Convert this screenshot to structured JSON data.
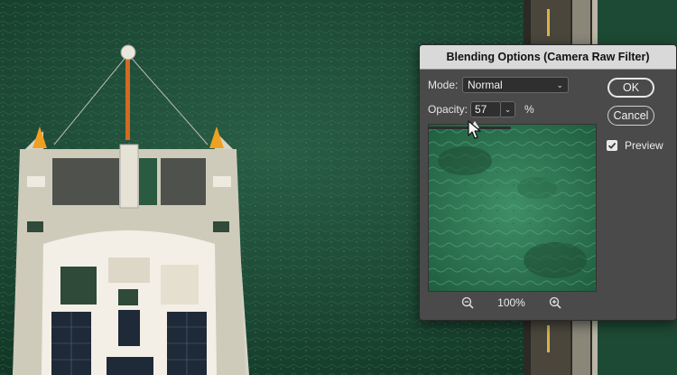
{
  "dialog": {
    "title": "Blending Options (Camera Raw Filter)",
    "mode_label": "Mode:",
    "mode_value": "Normal",
    "opacity_label": "Opacity:",
    "opacity_value": "57",
    "opacity_unit": "%",
    "opacity_fraction": 0.57,
    "zoom_level": "100%",
    "ok_label": "OK",
    "cancel_label": "Cancel",
    "preview_label": "Preview",
    "preview_checked": true
  },
  "icons": {
    "mode_dropdown": "chevron-down-icon",
    "opacity_dropdown": "chevron-down-icon",
    "zoom_out": "zoom-out-icon",
    "zoom_in": "zoom-in-icon",
    "preview_check": "checkmark-icon",
    "cursor": "pointer-cursor-icon"
  },
  "colors": {
    "dialog_bg": "#4a4a4a",
    "titlebar_bg": "#d9d9d9",
    "water": "#1c4a34",
    "boat_deck": "#d6d2c4"
  }
}
